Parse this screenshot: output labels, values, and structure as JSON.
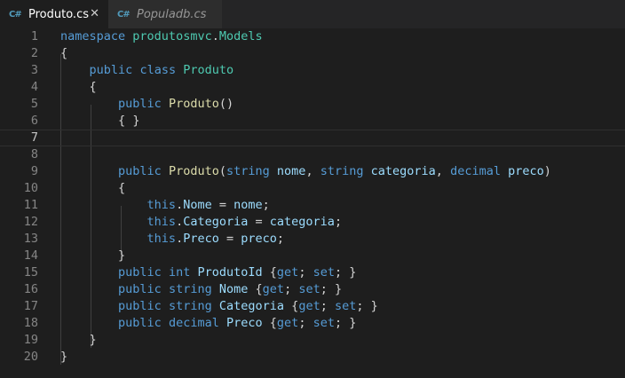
{
  "tabs": [
    {
      "icon": "C#",
      "label": "Produto.cs",
      "close": "✕"
    },
    {
      "icon": "C#",
      "label": "Populadb.cs"
    }
  ],
  "editor": {
    "active_line": 7,
    "lines": [
      {
        "num": "1",
        "code": "namespace produtosmvc.Models"
      },
      {
        "num": "2",
        "code": "{"
      },
      {
        "num": "3",
        "code": "    public class Produto"
      },
      {
        "num": "4",
        "code": "    {"
      },
      {
        "num": "5",
        "code": "        public Produto()"
      },
      {
        "num": "6",
        "code": "        { }"
      },
      {
        "num": "7",
        "code": ""
      },
      {
        "num": "8",
        "code": ""
      },
      {
        "num": "9",
        "code": "        public Produto(string nome, string categoria, decimal preco)"
      },
      {
        "num": "10",
        "code": "        {"
      },
      {
        "num": "11",
        "code": "            this.Nome = nome;"
      },
      {
        "num": "12",
        "code": "            this.Categoria = categoria;"
      },
      {
        "num": "13",
        "code": "            this.Preco = preco;"
      },
      {
        "num": "14",
        "code": "        }"
      },
      {
        "num": "15",
        "code": "        public int ProdutoId {get; set; }"
      },
      {
        "num": "16",
        "code": "        public string Nome {get; set; }"
      },
      {
        "num": "17",
        "code": "        public string Categoria {get; set; }"
      },
      {
        "num": "18",
        "code": "        public decimal Preco {get; set; }"
      },
      {
        "num": "19",
        "code": "    }"
      },
      {
        "num": "20",
        "code": "}"
      }
    ]
  },
  "colors": {
    "background": "#1e1e1e",
    "keyword": "#569cd6",
    "type": "#4ec9b0",
    "function": "#dcdcaa",
    "property": "#9cdcfe",
    "text": "#d4d4d4"
  }
}
